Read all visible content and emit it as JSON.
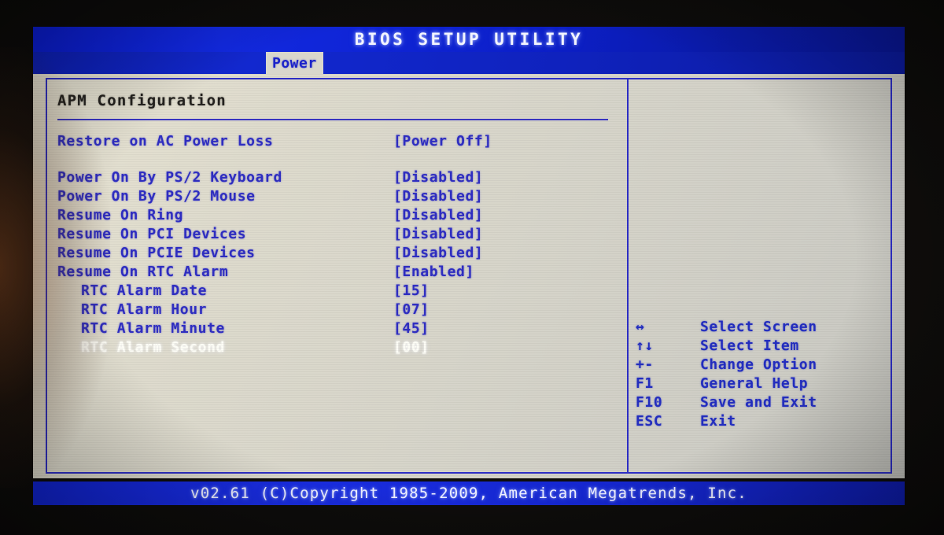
{
  "header": {
    "title": "BIOS SETUP UTILITY",
    "active_tab": "Power",
    "tabs": [
      "Power"
    ]
  },
  "main": {
    "section_title": "APM Configuration",
    "value_column_label": "",
    "items": [
      {
        "label": "Restore on AC Power Loss",
        "value": "[Power Off]",
        "indent": false,
        "selected": false,
        "gap_before": false
      },
      {
        "label": "Power On By PS/2 Keyboard",
        "value": "[Disabled]",
        "indent": false,
        "selected": false,
        "gap_before": true
      },
      {
        "label": "Power On By PS/2 Mouse",
        "value": "[Disabled]",
        "indent": false,
        "selected": false,
        "gap_before": false
      },
      {
        "label": "Resume On Ring",
        "value": "[Disabled]",
        "indent": false,
        "selected": false,
        "gap_before": false
      },
      {
        "label": "Resume On PCI Devices",
        "value": "[Disabled]",
        "indent": false,
        "selected": false,
        "gap_before": false
      },
      {
        "label": "Resume On PCIE Devices",
        "value": "[Disabled]",
        "indent": false,
        "selected": false,
        "gap_before": false
      },
      {
        "label": "Resume On RTC Alarm",
        "value": "[Enabled]",
        "indent": false,
        "selected": false,
        "gap_before": false
      },
      {
        "label": "RTC Alarm Date",
        "value": "[15]",
        "indent": true,
        "selected": false,
        "gap_before": false
      },
      {
        "label": "RTC Alarm Hour",
        "value": "[07]",
        "indent": true,
        "selected": false,
        "gap_before": false
      },
      {
        "label": "RTC Alarm Minute",
        "value": "[45]",
        "indent": true,
        "selected": false,
        "gap_before": false
      },
      {
        "label": "RTC Alarm Second",
        "value": "[00]",
        "indent": true,
        "selected": true,
        "gap_before": false
      }
    ]
  },
  "help": {
    "keys": [
      {
        "key": "↔",
        "desc": "Select Screen",
        "icon": "left-right-arrow-icon"
      },
      {
        "key": "↑↓",
        "desc": "Select Item",
        "icon": "up-down-arrow-icon"
      },
      {
        "key": "+-",
        "desc": "Change Option",
        "icon": "plus-minus-icon"
      },
      {
        "key": "F1",
        "desc": "General Help",
        "icon": "f1-key-icon"
      },
      {
        "key": "F10",
        "desc": "Save and Exit",
        "icon": "f10-key-icon"
      },
      {
        "key": "ESC",
        "desc": "Exit",
        "icon": "esc-key-icon"
      }
    ]
  },
  "footer": {
    "copyright": "v02.61 (C)Copyright 1985-2009, American Megatrends, Inc."
  },
  "colors": {
    "header_blue": "#1229e0",
    "footer_blue": "#1a2ddf",
    "panel_bg": "#d8d6cb",
    "text_blue": "#2f2ec2",
    "text_dark": "#24221f",
    "selected_text": "#fdfdf6",
    "frame_blue": "#2d2ec6"
  }
}
